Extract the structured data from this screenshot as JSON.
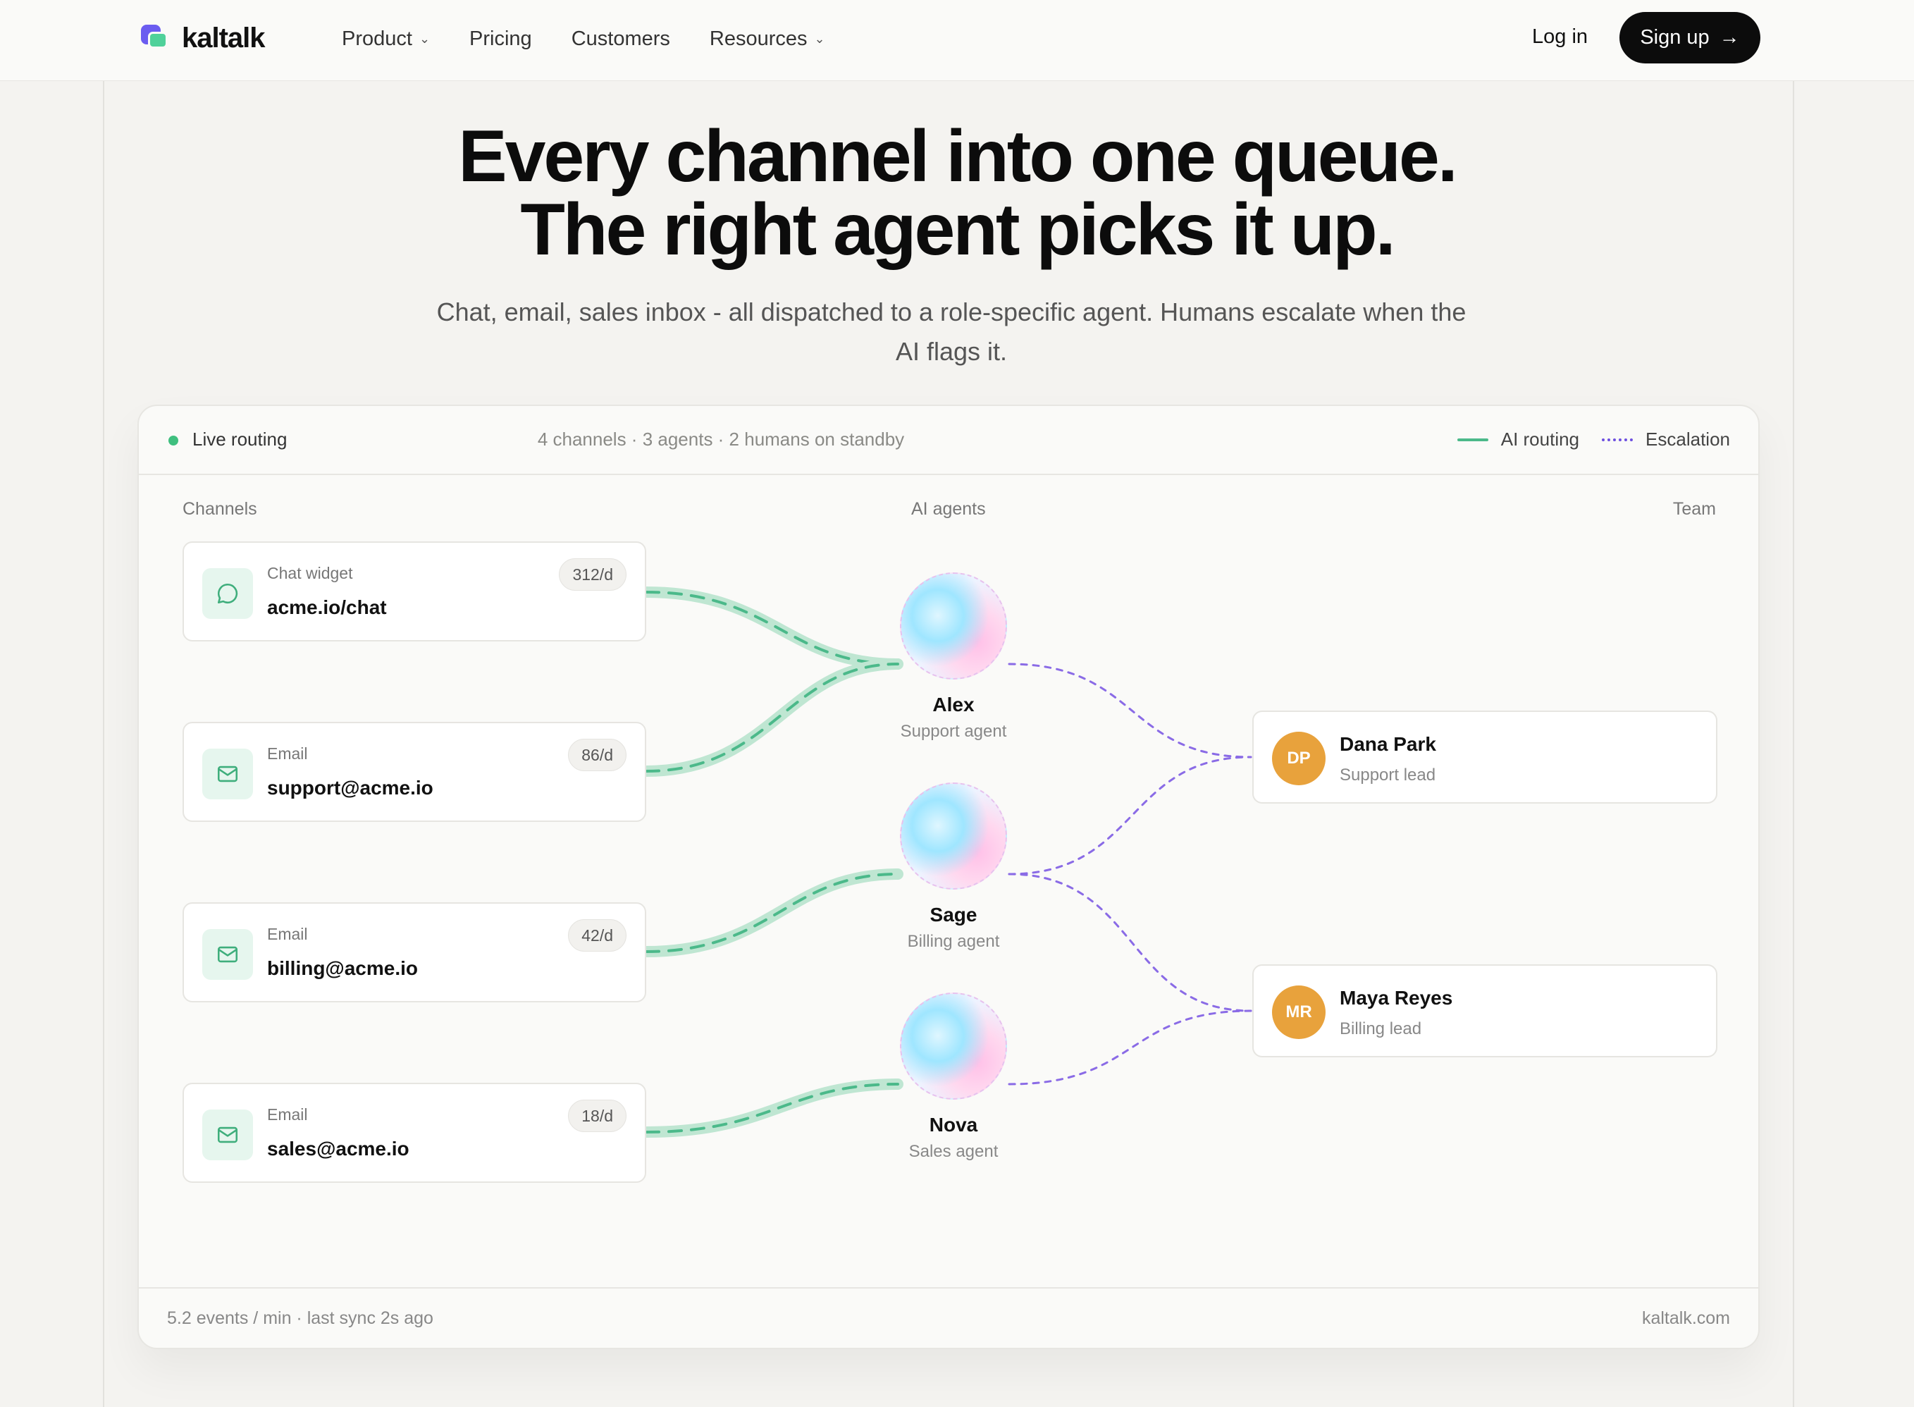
{
  "nav": {
    "brand": "kaltalk",
    "links": [
      {
        "label": "Product",
        "has_menu": true
      },
      {
        "label": "Pricing",
        "has_menu": false
      },
      {
        "label": "Customers",
        "has_menu": false
      },
      {
        "label": "Resources",
        "has_menu": true
      }
    ],
    "login": "Log in",
    "signup": "Sign up"
  },
  "hero": {
    "title_line1": "Every channel into one queue.",
    "title_line2": "The right agent picks it up.",
    "subtitle": "Chat, email, sales inbox - all dispatched to a role-specific agent. Humans escalate when the AI flags it."
  },
  "panel": {
    "status": "Live routing",
    "stats": "4 channels · 3 agents · 2 humans on standby",
    "legend_ai": "AI routing",
    "legend_escalation": "Escalation",
    "col_channels": "Channels",
    "col_agents": "AI agents",
    "col_team": "Team",
    "footer_left": "5.2 events / min · last sync 2s ago",
    "footer_right": "kaltalk.com",
    "colors": {
      "ai_routing": "#4bb98a",
      "escalation": "#6d4fe0",
      "avatar": "#e8a23c"
    }
  },
  "channels": [
    {
      "kind": "Chat widget",
      "address": "acme.io/chat",
      "rate": "312/d",
      "icon": "chat-bubble-icon"
    },
    {
      "kind": "Email",
      "address": "support@acme.io",
      "rate": "86/d",
      "icon": "mail-icon"
    },
    {
      "kind": "Email",
      "address": "billing@acme.io",
      "rate": "42/d",
      "icon": "mail-icon"
    },
    {
      "kind": "Email",
      "address": "sales@acme.io",
      "rate": "18/d",
      "icon": "mail-icon"
    }
  ],
  "agents": [
    {
      "name": "Alex",
      "role": "Support agent"
    },
    {
      "name": "Sage",
      "role": "Billing agent"
    },
    {
      "name": "Nova",
      "role": "Sales agent"
    }
  ],
  "team": [
    {
      "initials": "DP",
      "name": "Dana Park",
      "role": "Support lead"
    },
    {
      "initials": "MR",
      "name": "Maya Reyes",
      "role": "Billing lead"
    }
  ]
}
